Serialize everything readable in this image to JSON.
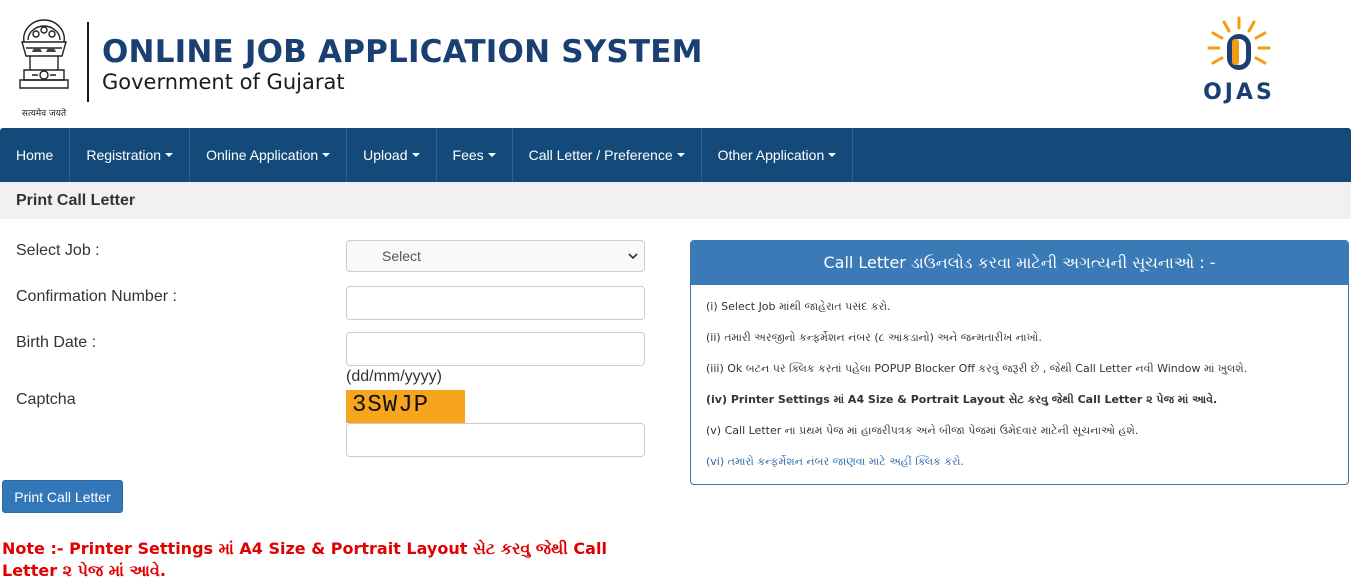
{
  "header": {
    "title": "ONLINE JOB APPLICATION SYSTEM",
    "subtitle": "Government of Gujarat",
    "emblem_caption": "सत्यमेव जयते",
    "logo_text": "OJAS"
  },
  "nav": {
    "items": [
      {
        "label": "Home",
        "dropdown": false
      },
      {
        "label": "Registration",
        "dropdown": true
      },
      {
        "label": "Online Application",
        "dropdown": true
      },
      {
        "label": "Upload ",
        "dropdown": true
      },
      {
        "label": "Fees ",
        "dropdown": true
      },
      {
        "label": "Call Letter / Preference ",
        "dropdown": true
      },
      {
        "label": "Other Application ",
        "dropdown": true
      }
    ]
  },
  "page": {
    "section_title": "Print Call Letter"
  },
  "form": {
    "job_label": "Select Job :",
    "job_selected": "Select",
    "confirmation_label": "Confirmation Number :",
    "confirmation_value": "",
    "birth_label": "Birth Date :",
    "birth_value": "",
    "birth_hint": "(dd/mm/yyyy)",
    "captcha_label": "Captcha",
    "captcha_code": "3SWJP",
    "captcha_value": "",
    "submit_label": "Print Call Letter"
  },
  "note": "Note :- Printer Settings માં A4 Size & Portrait Layout સેટ કરવુ જેથી Call Letter ૨ પેજ માં આવે.",
  "instructions": {
    "title": "Call Letter ડાઉનલોડ કરવા માટેની અગત્યની સૂચનાઓ : -",
    "items": [
      "(i) Select Job માંથી જાહેરાત પસંદ કરો.",
      "(ii) તમારી અરજીનો કન્ફર્મેશન નંબર (૮ આંકડાનો) અને જન્મતારીખ નાખો.",
      "(iii) Ok બટન પર ક્લિક કરતાં પહેલા POPUP Blocker Off કરવું જરૂરી છે , જેથી Call Letter નવી Window માં ખુલશે.",
      "(iv) Printer Settings માં A4 Size & Portrait Layout સેટ કરવુ જેથી Call Letter ૨ પેજ માં આવે.",
      "(v) Call Letter ના પ્રથમ પેજ માં હાજરીપત્રક અને બીજા પેજમાં ઉમેદવાર માટેની સૂચનાઓ હશે.",
      "(vi) તમારો કન્ફર્મેશન નંબર જાણવા માટે અહીં ક્લિક કરો."
    ]
  },
  "colors": {
    "navbar": "#144a7a",
    "title_blue": "#1a3f73",
    "panel_head": "#3a7ab7",
    "captcha_bg": "#f7a51c",
    "note_red": "#e00000",
    "button": "#3277b7"
  }
}
